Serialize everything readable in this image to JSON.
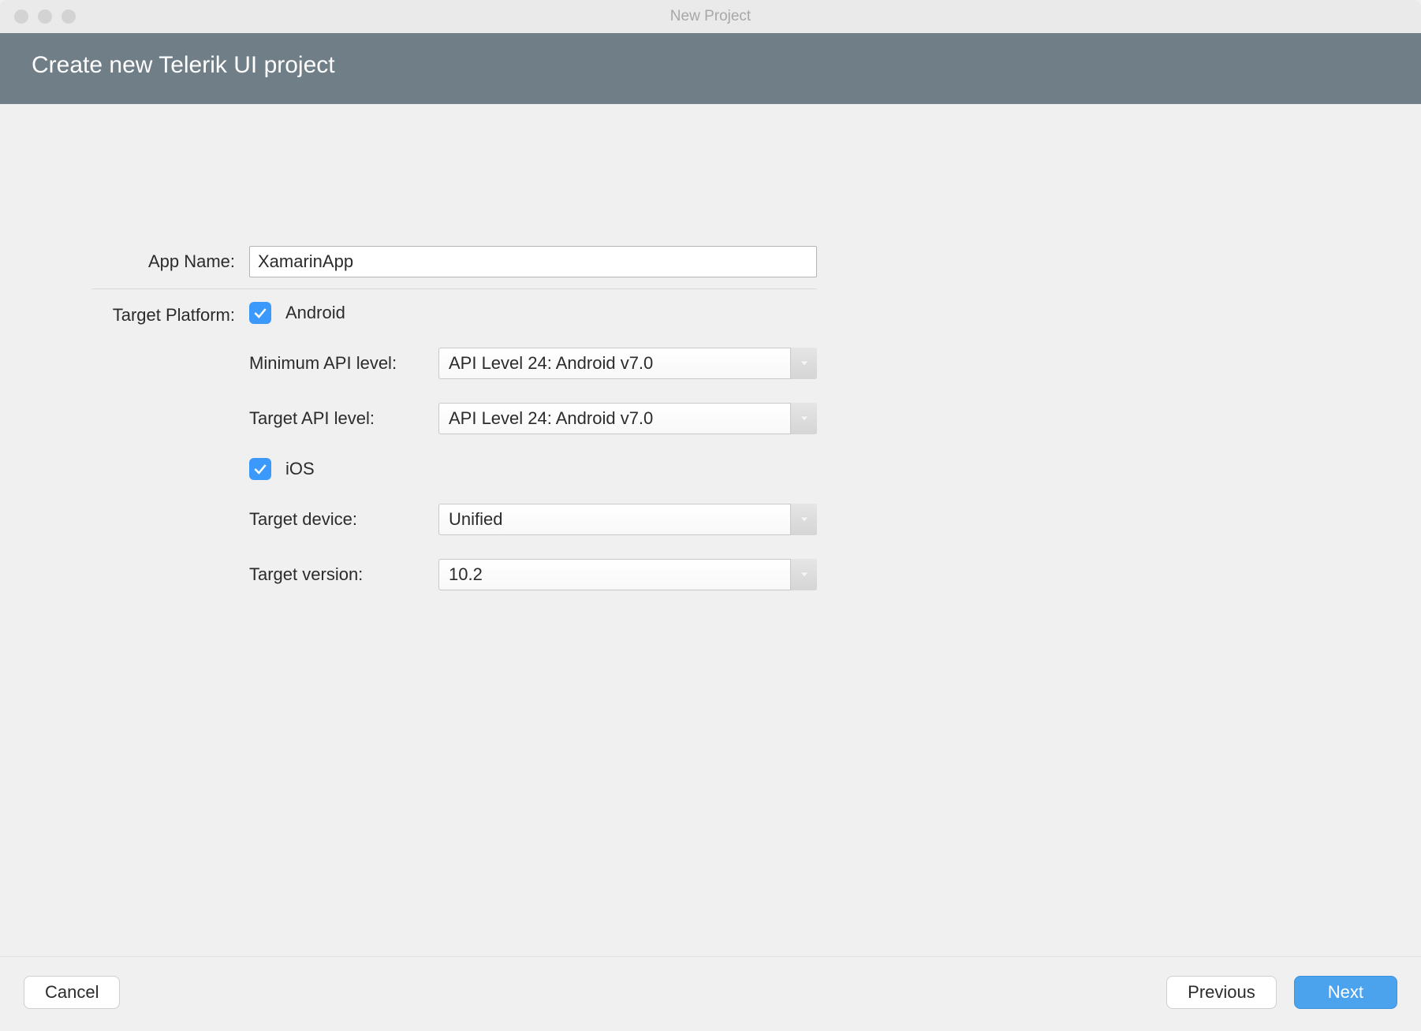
{
  "window": {
    "title": "New Project"
  },
  "header": {
    "title": "Create new Telerik UI project"
  },
  "form": {
    "appNameLabel": "App Name:",
    "appNameValue": "XamarinApp",
    "targetPlatformLabel": "Target Platform:",
    "android": {
      "label": "Android",
      "checked": true,
      "minApiLabel": "Minimum API level:",
      "minApiValue": "API Level 24: Android v7.0",
      "targetApiLabel": "Target API level:",
      "targetApiValue": "API Level 24: Android v7.0"
    },
    "ios": {
      "label": "iOS",
      "checked": true,
      "targetDeviceLabel": "Target device:",
      "targetDeviceValue": "Unified",
      "targetVersionLabel": "Target version:",
      "targetVersionValue": "10.2"
    }
  },
  "footer": {
    "cancel": "Cancel",
    "previous": "Previous",
    "next": "Next"
  }
}
